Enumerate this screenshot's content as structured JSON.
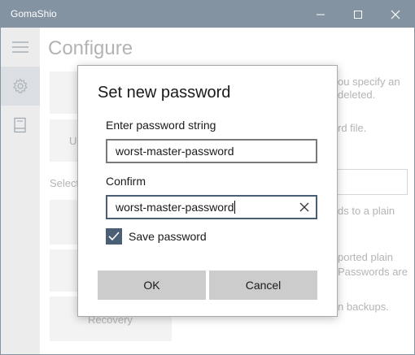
{
  "window": {
    "title": "GomaShio",
    "minimize_icon": "minimize-icon",
    "maximize_icon": "maximize-icon",
    "close_icon": "close-icon"
  },
  "sidebar": {
    "items": [
      {
        "icon": "hamburger-icon"
      },
      {
        "icon": "gear-icon",
        "active": true
      },
      {
        "icon": "book-icon"
      }
    ]
  },
  "page": {
    "heading": "Configure",
    "select_label": "Select",
    "tile_partial_label": "Us",
    "tile_recovery_label": "Recovery",
    "text_fragments": [
      "ou specify an",
      "deleted.",
      "rd file.",
      "ds to a plain",
      "ported plain",
      "Passwords are",
      "n backups."
    ]
  },
  "dialog": {
    "title": "Set new password",
    "password_label": "Enter password string",
    "password_value": "worst-master-password",
    "confirm_label": "Confirm",
    "confirm_value": "worst-master-password",
    "save_password_label": "Save password",
    "save_password_checked": true,
    "ok_label": "OK",
    "cancel_label": "Cancel"
  },
  "colors": {
    "accent": "#5a6f82",
    "checkbox": "#4a5f73",
    "button": "#cccccc"
  }
}
